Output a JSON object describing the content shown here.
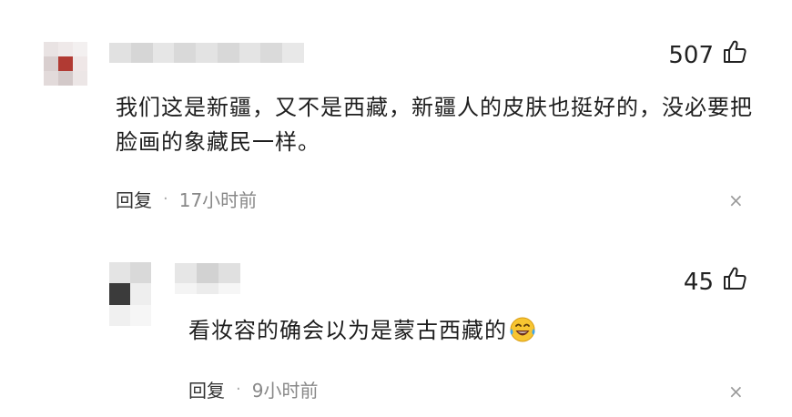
{
  "comments": [
    {
      "text": "我们这是新疆，又不是西藏，新疆人的皮肤也挺好的，没必要把脸画的象藏民一样。",
      "likes": "507",
      "reply_label": "回复",
      "separator": "·",
      "time": "17小时前",
      "close": "×"
    },
    {
      "text": "看妆容的确会以为是蒙古西藏的",
      "likes": "45",
      "reply_label": "回复",
      "separator": "·",
      "time": "9小时前",
      "close": "×",
      "emoji": "laughing-tears-emoji"
    }
  ],
  "colors": {
    "text": "#1e1e1e",
    "meta": "#888888",
    "accent_avatar": "#c0392b"
  },
  "icons": {
    "like": "thumbs-up-icon",
    "close": "close-icon"
  }
}
